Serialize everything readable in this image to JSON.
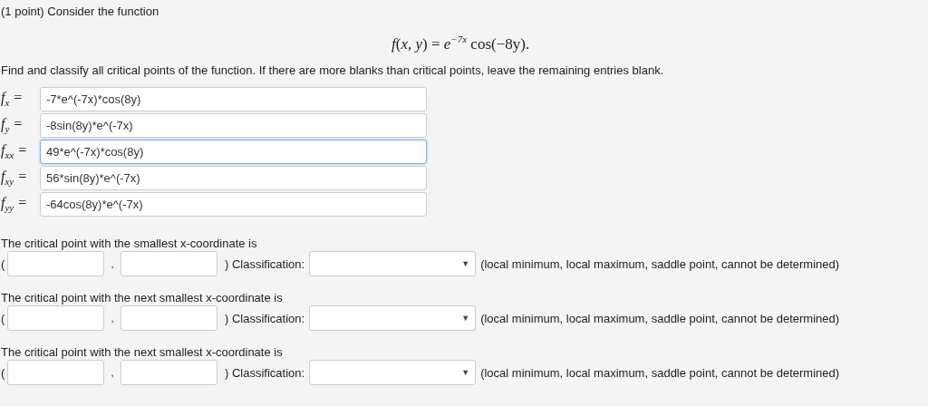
{
  "header": "(1 point) Consider the function",
  "formula": "*f*(*x*, *y*) = *e*$^{−7x}$ cos(−8y).",
  "instructions": "Find and classify all critical points of the function. If there are more blanks than critical points, leave the remaining entries blank.",
  "derivatives": [
    {
      "label": "*f*$_{x}$ =",
      "value": "-7*e^(-7x)*cos(8y)",
      "focused": false
    },
    {
      "label": "*f*$_{y}$ =",
      "value": "-8sin(8y)*e^(-7x)",
      "focused": false
    },
    {
      "label": "*f*$_{xx}$ =",
      "value": "49*e^(-7x)*cos(8y)",
      "focused": true
    },
    {
      "label": "*f*$_{xy}$ =",
      "value": "56*sin(8y)*e^(-7x)",
      "focused": false
    },
    {
      "label": "*f*$_{yy}$ =",
      "value": "-64cos(8y)*e^(-7x)",
      "focused": false
    }
  ],
  "critical_points": [
    {
      "prompt": "The critical point with the smallest x-coordinate is",
      "open_paren": "(",
      "comma": ",",
      "close_label": ") Classification:",
      "arrow": "▼",
      "hint": "(local minimum, local maximum, saddle point, cannot be determined)"
    },
    {
      "prompt": "The critical point with the next smallest x-coordinate is",
      "open_paren": "(",
      "comma": ",",
      "close_label": ") Classification:",
      "arrow": "▼",
      "hint": "(local minimum, local maximum, saddle point, cannot be determined)"
    },
    {
      "prompt": "The critical point with the next smallest x-coordinate is",
      "open_paren": "(",
      "comma": ",",
      "close_label": ") Classification:",
      "arrow": "▼",
      "hint": "(local minimum, local maximum, saddle point, cannot be determined)"
    }
  ]
}
